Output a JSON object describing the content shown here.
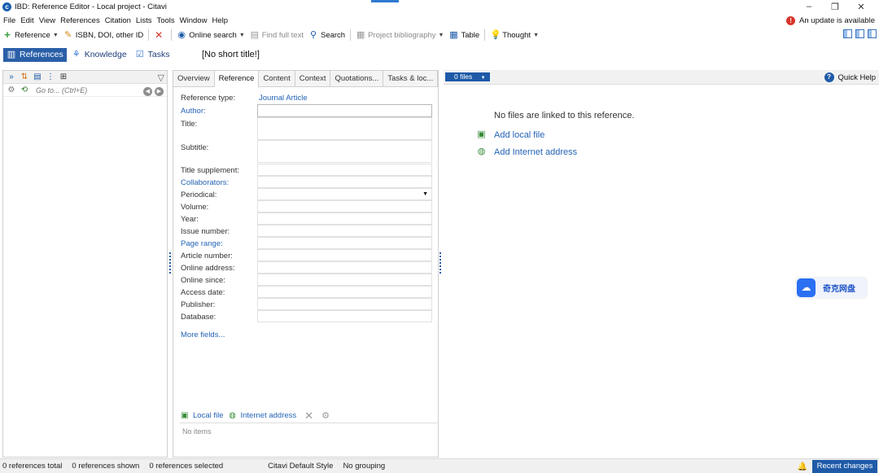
{
  "window": {
    "title": "IBD: Reference Editor - Local project - Citavi",
    "minimize": "–",
    "maximize": "❐",
    "close": "✕"
  },
  "menu": [
    "File",
    "Edit",
    "View",
    "References",
    "Citation",
    "Lists",
    "Tools",
    "Window",
    "Help"
  ],
  "update_notice": "An update is available",
  "toolbar": {
    "reference": "Reference",
    "isbn": "ISBN, DOI, other ID",
    "online_search": "Online search",
    "find_full_text": "Find full text",
    "search": "Search",
    "project_bibliography": "Project bibliography",
    "table": "Table",
    "thought": "Thought"
  },
  "nav": {
    "references": "References",
    "knowledge": "Knowledge",
    "tasks": "Tasks"
  },
  "short_title": "[No short title!]",
  "left_pane": {
    "goto_placeholder": "Go to... (Ctrl+E)"
  },
  "tabs": [
    "Overview",
    "Reference",
    "Content",
    "Context",
    "Quotations...",
    "Tasks & loc..."
  ],
  "active_tab": "Reference",
  "fields": {
    "reference_type": "Reference type:",
    "reference_type_value": "Journal Article",
    "author": "Author:",
    "title": "Title:",
    "subtitle": "Subtitle:",
    "title_supplement": "Title supplement:",
    "collaborators": "Collaborators:",
    "periodical": "Periodical:",
    "volume": "Volume:",
    "year": "Year:",
    "issue_number": "Issue number:",
    "page_range": "Page range:",
    "article_number": "Article number:",
    "online_address": "Online address:",
    "online_since": "Online since:",
    "access_date": "Access date:",
    "publisher": "Publisher:",
    "database": "Database:",
    "more_fields": "More fields..."
  },
  "attachments": {
    "local_file": "Local file",
    "internet_address": "Internet address",
    "no_items": "No items"
  },
  "right_pane": {
    "files_count": "0 files",
    "quick_help": "Quick Help",
    "no_files": "No files are linked to this reference.",
    "add_local_file": "Add local file",
    "add_internet_address": "Add Internet address"
  },
  "cloud_widget": "奇克网盘",
  "status": {
    "total": "0 references total",
    "shown": "0 references shown",
    "selected": "0 references selected",
    "style": "Citavi Default Style",
    "grouping": "No grouping",
    "recent_changes": "Recent changes"
  },
  "colors": {
    "accent": "#2a5fa8",
    "link": "#2463b5",
    "update_icon": "#d9342b"
  }
}
